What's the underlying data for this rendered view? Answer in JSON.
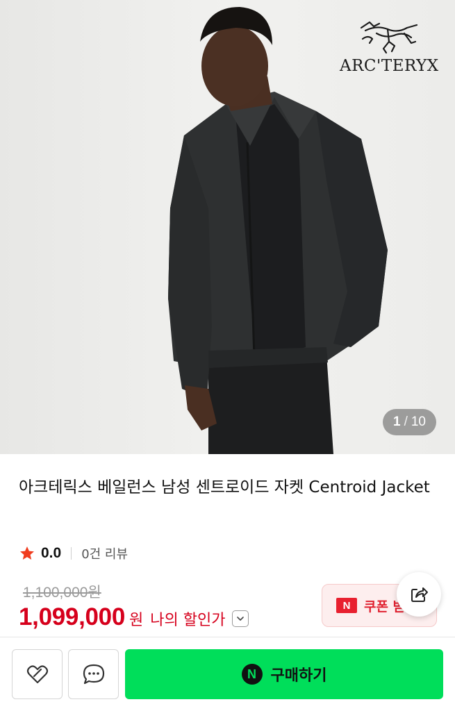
{
  "product_image": {
    "brand_name": "ARC'TERYX",
    "pager": {
      "current": "1",
      "separator": "/",
      "total": "10"
    }
  },
  "product": {
    "title": "아크테릭스 베일런스 남성 센트로이드 자켓 Centroid Jacket",
    "rating": {
      "score": "0.0",
      "review_count": "0건 리뷰",
      "star_color": "#f03c1e"
    },
    "original_price": "1,100,000원",
    "price": "1,099,000",
    "currency": "원",
    "my_discount_label": "나의 할인가"
  },
  "coupon": {
    "badge": "N",
    "label": "쿠폰 받기"
  },
  "bottom_bar": {
    "buy_badge": "N",
    "buy_label": "구매하기",
    "buy_color": "#00de5a"
  },
  "icons": {
    "share": "share-icon",
    "wish": "heart-icon",
    "talk": "chat-bubble-icon",
    "chevron": "chevron-down-icon",
    "star": "star-icon"
  }
}
